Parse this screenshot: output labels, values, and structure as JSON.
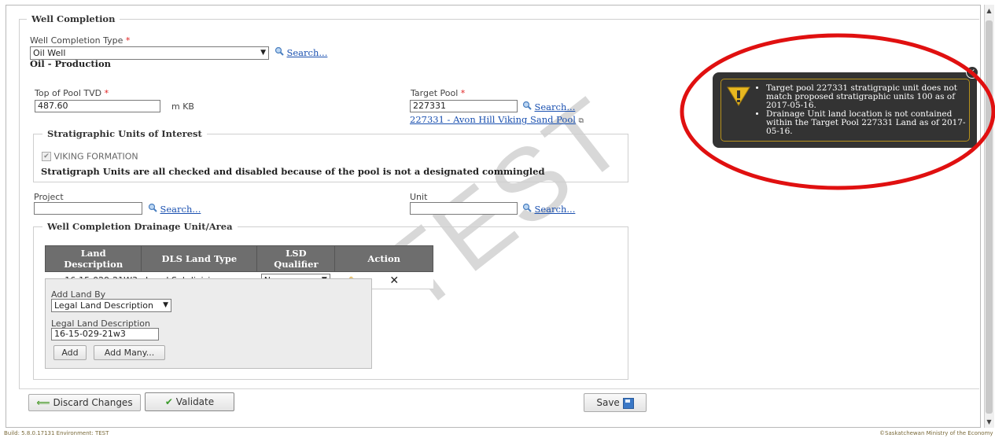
{
  "watermark": "TEST",
  "well_completion": {
    "legend": "Well Completion",
    "type_label": "Well Completion Type",
    "type_value": "Oil Well",
    "type_search": "Search...",
    "type_description": "Oil - Production",
    "top_of_pool_label": "Top of Pool TVD",
    "top_of_pool_value": "487.60",
    "top_of_pool_unit": "m KB",
    "target_pool_label": "Target Pool",
    "target_pool_value": "227331",
    "target_pool_search": "Search...",
    "target_pool_link": "227331 - Avon Hill Viking Sand Pool",
    "required_marker": "*"
  },
  "strat_units": {
    "legend": "Stratigraphic Units of Interest",
    "items": [
      {
        "label": "VIKING FORMATION",
        "checked": true
      }
    ],
    "note": "Stratigraph Units are all checked and disabled because of the pool is not a designated commingled"
  },
  "project": {
    "label": "Project",
    "value": "",
    "search": "Search..."
  },
  "unit": {
    "label": "Unit",
    "value": "",
    "search": "Search..."
  },
  "drainage": {
    "legend": "Well Completion Drainage Unit/Area",
    "columns": [
      "Land Description",
      "DLS Land Type",
      "LSD Qualifier",
      "Action"
    ],
    "rows": [
      {
        "land_description": "16-15-029-21W3",
        "dls_land_type": "Legal Subdivision",
        "lsd_qualifier": "None"
      }
    ],
    "add_land_by_label": "Add Land By",
    "add_land_by_value": "Legal Land Description",
    "legal_land_label": "Legal Land Description",
    "legal_land_value": "16-15-029-21w3",
    "add_button": "Add",
    "add_many_button": "Add Many..."
  },
  "actions": {
    "discard": "Discard Changes",
    "validate": "Validate",
    "save": "Save"
  },
  "tooltip": {
    "messages": [
      "Target pool 227331 stratigrapic unit does not match proposed stratigraphic units 100 as of 2017-05-16.",
      "Drainage Unit land location is not contained within the Target Pool 227331 Land as of 2017-05-16."
    ]
  },
  "footer": {
    "build": "Build: 5.8.0.17131 Environment: TEST",
    "copyright": "©Saskatchewan Ministry of the Economy"
  },
  "colors": {
    "highlight_circle": "#e01010",
    "tooltip_bg": "#333333",
    "warning_icon": "#e8b820",
    "link": "#1a50b0"
  }
}
